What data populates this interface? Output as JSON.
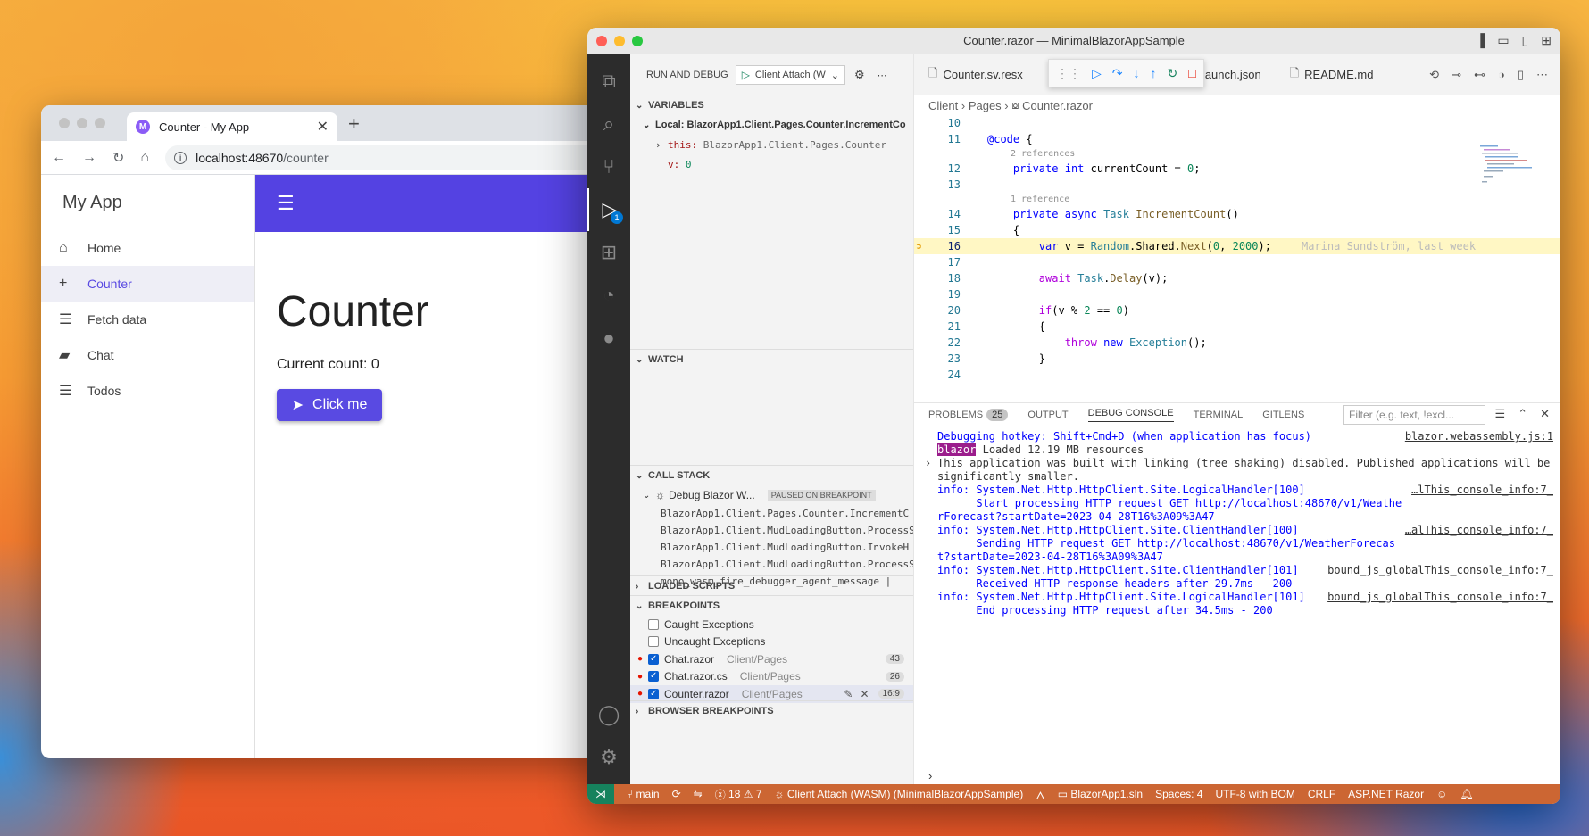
{
  "browser": {
    "tab_title": "Counter - My App",
    "favicon_letter": "M",
    "url_host": "localhost:48670",
    "url_path": "/counter",
    "app": {
      "brand": "My App",
      "nav": [
        {
          "label": "Home",
          "icon": "home-icon",
          "active": false
        },
        {
          "label": "Counter",
          "icon": "plus-icon",
          "active": true
        },
        {
          "label": "Fetch data",
          "icon": "list-icon",
          "active": false
        },
        {
          "label": "Chat",
          "icon": "chat-icon",
          "active": false
        },
        {
          "label": "Todos",
          "icon": "list-icon",
          "active": false
        }
      ],
      "page_title": "Counter",
      "current_count": "Current count: 0",
      "button_label": "Click me"
    }
  },
  "vscode": {
    "window_title": "Counter.razor — MinimalBlazorAppSample",
    "run_debug_title": "RUN AND DEBUG",
    "launch_config": "Client Attach (W",
    "variables": {
      "header": "VARIABLES",
      "scope": "Local: BlazorApp1.Client.Pages.Counter.IncrementCo",
      "items": [
        {
          "name": "this:",
          "value": "BlazorApp1.Client.Pages.Counter"
        },
        {
          "name": "v:",
          "value": "0"
        }
      ]
    },
    "watch_header": "WATCH",
    "call_stack": {
      "header": "CALL STACK",
      "thread": "Debug Blazor W...",
      "thread_status": "PAUSED ON BREAKPOINT",
      "frames": [
        "BlazorApp1.Client.Pages.Counter.IncrementC",
        "BlazorApp1.Client.MudLoadingButton.ProcessS",
        "BlazorApp1.Client.MudLoadingButton.InvokeH",
        "BlazorApp1.Client.MudLoadingButton.ProcessS",
        "mono_wasm_fire_debugger_agent_message  |"
      ]
    },
    "loaded_scripts_header": "LOADED SCRIPTS",
    "breakpoints": {
      "header": "BREAKPOINTS",
      "items": [
        {
          "label": "Caught Exceptions",
          "path": "",
          "checked": false,
          "count": "",
          "dot": false
        },
        {
          "label": "Uncaught Exceptions",
          "path": "",
          "checked": false,
          "count": "",
          "dot": false
        },
        {
          "label": "Chat.razor",
          "path": "Client/Pages",
          "checked": true,
          "count": "43",
          "dot": true
        },
        {
          "label": "Chat.razor.cs",
          "path": "Client/Pages",
          "checked": true,
          "count": "26",
          "dot": true
        },
        {
          "label": "Counter.razor",
          "path": "Client/Pages",
          "checked": true,
          "count": "16:9",
          "dot": true
        }
      ]
    },
    "browser_breakpoints_header": "BROWSER BREAKPOINTS",
    "editor_tabs": [
      "Counter.sv.resx",
      "aunch.json",
      "README.md"
    ],
    "breadcrumb": [
      "Client",
      "Pages",
      "Counter.razor"
    ],
    "code_lines": [
      {
        "n": "10",
        "lens": "",
        "html": ""
      },
      {
        "n": "11",
        "lens": "",
        "html": "<span class='at'>@code</span> {"
      },
      {
        "n": "12",
        "lens": "2 references",
        "html": "    <span class='kw'>private</span> <span class='kw'>int</span> currentCount = <span class='nm'>0</span>;"
      },
      {
        "n": "13",
        "lens": "",
        "html": ""
      },
      {
        "n": "14",
        "lens": "1 reference",
        "html": "    <span class='kw'>private</span> <span class='kw'>async</span> <span class='ty'>Task</span> <span class='fn'>IncrementCount</span>()"
      },
      {
        "n": "15",
        "lens": "",
        "html": "    {"
      },
      {
        "n": "16",
        "lens": "",
        "html": "        <span class='kw'>var</span> v = <span class='ty'>Random</span>.Shared.<span class='fn'>Next</span>(<span class='nm'>0</span>, <span class='nm'>2000</span>);",
        "hl": true,
        "blame": "Marina Sundström, last week"
      },
      {
        "n": "17",
        "lens": "",
        "html": ""
      },
      {
        "n": "18",
        "lens": "",
        "html": "        <span class='ctl'>await</span> <span class='ty'>Task</span>.<span class='fn'>Delay</span>(v);"
      },
      {
        "n": "19",
        "lens": "",
        "html": ""
      },
      {
        "n": "20",
        "lens": "",
        "html": "        <span class='ctl'>if</span>(v % <span class='nm'>2</span> == <span class='nm'>0</span>)"
      },
      {
        "n": "21",
        "lens": "",
        "html": "        {"
      },
      {
        "n": "22",
        "lens": "",
        "html": "            <span class='ctl'>throw</span> <span class='kw'>new</span> <span class='ty'>Exception</span>();"
      },
      {
        "n": "23",
        "lens": "",
        "html": "        }"
      },
      {
        "n": "24",
        "lens": "",
        "html": ""
      }
    ],
    "panel_tabs": [
      {
        "label": "PROBLEMS",
        "count": "25",
        "active": false
      },
      {
        "label": "OUTPUT",
        "count": "",
        "active": false
      },
      {
        "label": "DEBUG CONSOLE",
        "count": "",
        "active": true
      },
      {
        "label": "TERMINAL",
        "count": "",
        "active": false
      },
      {
        "label": "GITLENS",
        "count": "",
        "active": false
      }
    ],
    "filter_placeholder": "Filter (e.g. text, !excl...",
    "console": [
      {
        "text": "Debugging hotkey: Shift+Cmd+D (when application has focus)",
        "src": "blazor.webassembly.js:1"
      },
      {
        "text": "Loaded 12.19 MB resources",
        "src": "",
        "tag": "blazor"
      },
      {
        "text": "This application was built with linking (tree shaking) disabled. Published applications will be",
        "src": "",
        "plain": true
      },
      {
        "text": "significantly smaller.",
        "src": "",
        "plain": true
      },
      {
        "text": "info: System.Net.Http.HttpClient.Site.LogicalHandler[100]",
        "src": "…lThis_console_info:7_"
      },
      {
        "text": "      Start processing HTTP request GET http://localhost:48670/v1/Weathe",
        "src": ""
      },
      {
        "text": "rForecast?startDate=2023-04-28T16%3A09%3A47",
        "src": ""
      },
      {
        "text": "info: System.Net.Http.HttpClient.Site.ClientHandler[100]",
        "src": "…alThis_console_info:7_"
      },
      {
        "text": "      Sending HTTP request GET http://localhost:48670/v1/WeatherForecas",
        "src": ""
      },
      {
        "text": "t?startDate=2023-04-28T16%3A09%3A47",
        "src": ""
      },
      {
        "text": "info: System.Net.Http.HttpClient.Site.ClientHandler[101]",
        "src": "bound_js_globalThis_console_info:7_"
      },
      {
        "text": "      Received HTTP response headers after 29.7ms - 200",
        "src": ""
      },
      {
        "text": "info: System.Net.Http.HttpClient.Site.LogicalHandler[101]",
        "src": "bound_js_globalThis_console_info:7_"
      },
      {
        "text": "      End processing HTTP request after 34.5ms - 200",
        "src": ""
      }
    ],
    "status": {
      "branch": "main",
      "errors": "18",
      "warnings": "7",
      "debug": "Client Attach (WASM) (MinimalBlazorAppSample)",
      "solution": "BlazorApp1.sln",
      "spaces": "Spaces: 4",
      "encoding": "UTF-8 with BOM",
      "eol": "CRLF",
      "language": "ASP.NET Razor"
    }
  }
}
